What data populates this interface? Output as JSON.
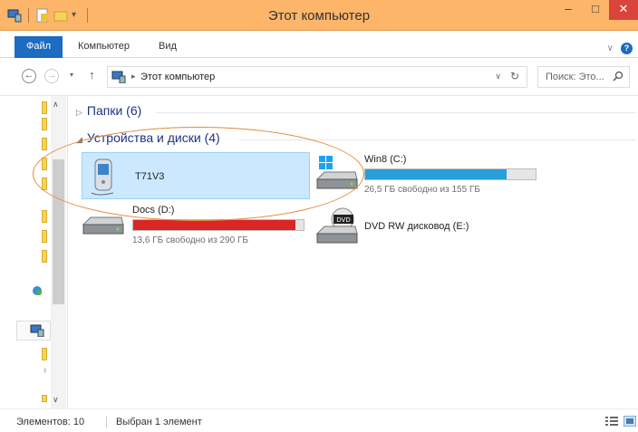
{
  "window": {
    "title": "Этот компьютер",
    "minimize": "–",
    "maximize": "□",
    "close": "✕"
  },
  "ribbon": {
    "tabs": [
      {
        "label": "Файл",
        "active": true
      },
      {
        "label": "Компьютер"
      },
      {
        "label": "Вид"
      }
    ],
    "chevron": "∨",
    "help": "?"
  },
  "address": {
    "back": "←",
    "forward": "→",
    "recent": "▾",
    "up": "↑",
    "separator": "▸",
    "path": "Этот компьютер",
    "dropdown": "∨",
    "refresh": "↻",
    "search_placeholder": "Поиск: Это..."
  },
  "groups": {
    "folders": {
      "label": "Папки (6)",
      "collapsed": true
    },
    "devices": {
      "label": "Устройства и диски (4)",
      "collapsed": false
    }
  },
  "devices": [
    {
      "name": "T71V3",
      "kind": "phone",
      "selected": true
    },
    {
      "name": "Win8 (C:)",
      "kind": "system-drive",
      "free": "26,5 ГБ свободно из 155 ГБ",
      "used_fraction": 0.83,
      "bar_color": "#26a0da"
    },
    {
      "name": "Docs (D:)",
      "kind": "drive",
      "free": "13,6 ГБ свободно из 290 ГБ",
      "used_fraction": 0.95,
      "bar_color": "#da2626"
    },
    {
      "name": "DVD RW дисковод (E:)",
      "kind": "dvd"
    }
  ],
  "status": {
    "count": "Элементов: 10",
    "selection": "Выбран 1 элемент"
  },
  "colors": {
    "titlebar": "#fdb56a",
    "file_tab": "#1c6cc0",
    "selection": "#cce8ff",
    "highlight_ellipse": "#e58a3a"
  }
}
